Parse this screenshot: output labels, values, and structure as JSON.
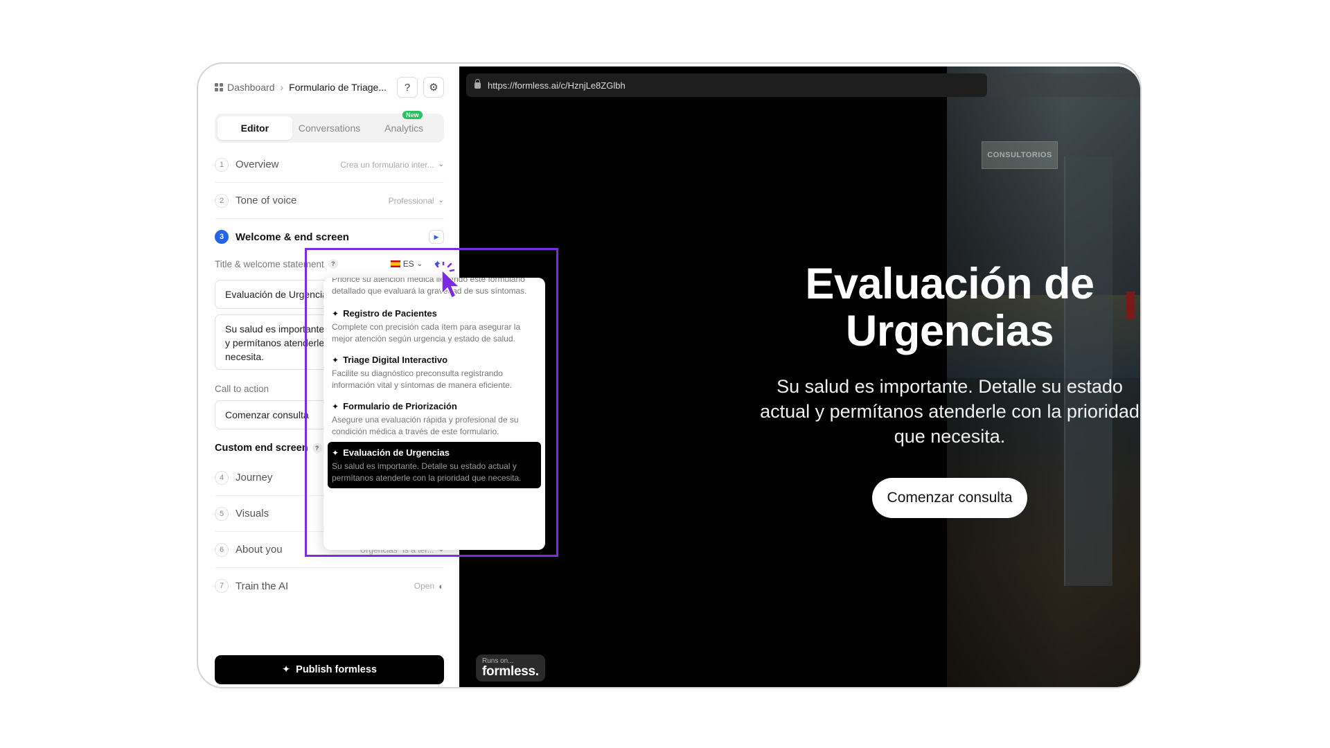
{
  "breadcrumb": {
    "root": "Dashboard",
    "current": "Formulario de Triage..."
  },
  "help_label": "?",
  "tabs": [
    {
      "label": "Editor",
      "active": true
    },
    {
      "label": "Conversations"
    },
    {
      "label": "Analytics",
      "badge": "New"
    }
  ],
  "steps": {
    "overview": {
      "num": "1",
      "label": "Overview",
      "summary": "Crea un formulario inter..."
    },
    "tone": {
      "num": "2",
      "label": "Tone of voice",
      "summary": "Professional"
    },
    "welcome": {
      "num": "3",
      "label": "Welcome & end screen"
    },
    "journey": {
      "num": "4",
      "label": "Journey"
    },
    "visuals": {
      "num": "5",
      "label": "Visuals"
    },
    "about": {
      "num": "6",
      "label": "About you",
      "summary": "\"Urgencias\" is a ter..."
    },
    "train": {
      "num": "7",
      "label": "Train the AI",
      "summary": "Open"
    }
  },
  "welcome_section": {
    "title_label": "Title & welcome statement",
    "language": "ES",
    "title_value": "Evaluación de Urgencias",
    "statement_value": "Su salud es importante. Detalle su estado actual y permítanos atenderle con la prioridad que necesita.",
    "cta_label": "Call to action",
    "cta_value": "Comenzar consulta",
    "custom_end_label": "Custom end screen"
  },
  "suggestions": {
    "partial_text": "Priorice su atención médica llenando este formulario detallado que evaluará la gravedad de sus síntomas.",
    "items": [
      {
        "title": "Registro de Pacientes",
        "desc": "Complete con precisión cada ítem para asegurar la mejor atención según urgencia y estado de salud."
      },
      {
        "title": "Triage Digital Interactivo",
        "desc": "Facilite su diagnóstico preconsulta registrando información vital y síntomas de manera eficiente."
      },
      {
        "title": "Formulario de Priorización",
        "desc": "Asegure una evaluación rápida y profesional de su condición médica a través de este formulario."
      },
      {
        "title": "Evaluación de Urgencias",
        "desc": "Su salud es importante. Detalle su estado actual y permítanos atenderle con la prioridad que necesita.",
        "selected": true
      }
    ]
  },
  "publish_label": "Publish formless",
  "preview": {
    "url": "https://formless.ai/c/HznjLe8ZGlbh",
    "photo_sign": "CONSULTORIOS",
    "title": "Evaluación de Urgencias",
    "subtitle": "Su salud es importante. Detalle su estado actual y permítanos atenderle con la prioridad que necesita.",
    "cta": "Comenzar consulta",
    "runs_on": "Runs on...",
    "brand": "formless."
  },
  "colors": {
    "accent": "#2563eb",
    "highlight": "#7c2ae8",
    "badge": "#22c55e"
  }
}
